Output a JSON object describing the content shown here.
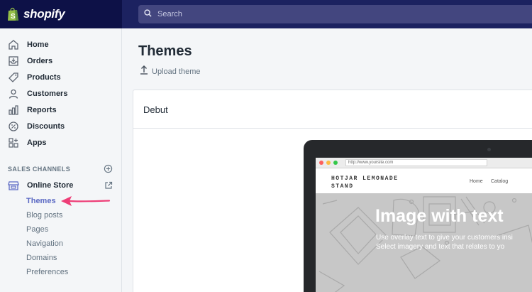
{
  "brand": {
    "name": "shopify",
    "color": "#95bf47"
  },
  "search": {
    "placeholder": "Search"
  },
  "sidebar": {
    "items": [
      {
        "label": "Home",
        "icon": "home-icon"
      },
      {
        "label": "Orders",
        "icon": "orders-icon"
      },
      {
        "label": "Products",
        "icon": "tag-icon"
      },
      {
        "label": "Customers",
        "icon": "person-icon"
      },
      {
        "label": "Reports",
        "icon": "bar-chart-icon"
      },
      {
        "label": "Discounts",
        "icon": "discount-icon"
      },
      {
        "label": "Apps",
        "icon": "apps-icon"
      }
    ],
    "sales_channels_title": "SALES CHANNELS",
    "online_store": {
      "label": "Online Store",
      "icon": "store-icon"
    },
    "sub_items": [
      "Themes",
      "Blog posts",
      "Pages",
      "Navigation",
      "Domains",
      "Preferences"
    ],
    "active_sub": "Themes"
  },
  "main": {
    "title": "Themes",
    "upload_label": "Upload theme",
    "card_title": "Debut"
  },
  "preview": {
    "url": "http://www.yoursite.com",
    "store_name": "HOTJAR LEMONADE STAND",
    "nav": [
      "Home",
      "Catalog"
    ],
    "hero_title": "Image with text",
    "hero_lines": [
      "Use overlay text to give your customers insi",
      "Select imagery and text that relates to yo"
    ]
  },
  "colors": {
    "topbar": "#1c2260",
    "accent": "#5c6ac4",
    "arrow": "#ee3e77"
  }
}
